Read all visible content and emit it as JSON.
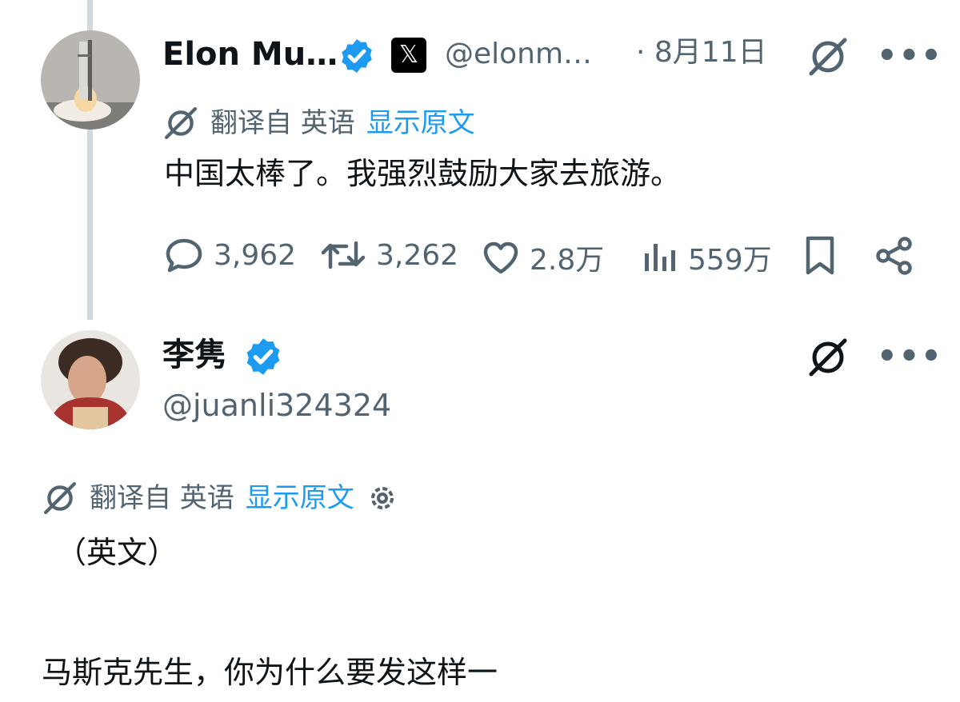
{
  "tweet": {
    "author_name": "Elon Mu…",
    "x_badge": "𝕏",
    "handle": "@elonm…",
    "date": "· 8月11日",
    "translated_from": "翻译自 英语",
    "show_original": "显示原文",
    "text": "中国太棒了。我强烈鼓励大家去旅游。",
    "stats": {
      "replies": "3,962",
      "reposts": "3,262",
      "likes": "2.8万",
      "views": "559万"
    }
  },
  "reply": {
    "author_name": "李隽",
    "handle": "@juanli324324",
    "translated_from": "翻译自 英语",
    "show_original": "显示原文",
    "line1": "（英文）",
    "line2": "马斯克先生，你为什么要发这样一"
  },
  "colors": {
    "verified": "#1d9bf0",
    "link": "#1d9bf0",
    "muted": "#536471"
  }
}
